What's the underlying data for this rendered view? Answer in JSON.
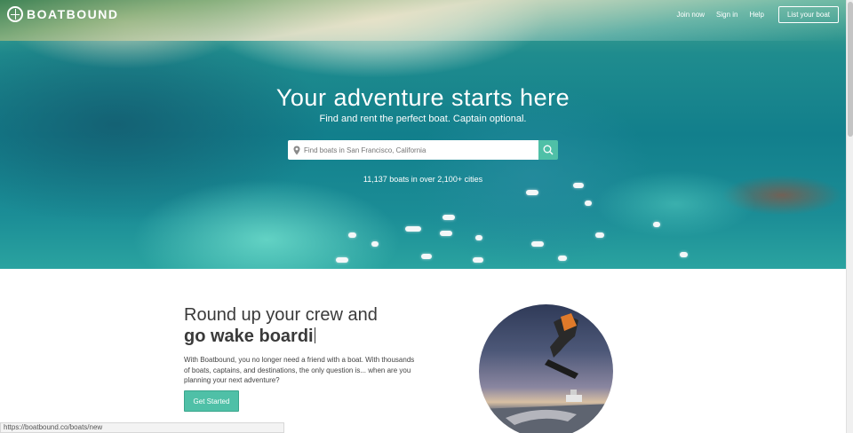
{
  "nav": {
    "logo_text": "BOATBOUND",
    "join_label": "Join now",
    "signin_label": "Sign in",
    "help_label": "Help",
    "list_boat_label": "List your boat"
  },
  "hero": {
    "title": "Your adventure starts here",
    "subtitle": "Find and rent the perfect boat. Captain optional.",
    "search_placeholder": "Find boats in San Francisco, California",
    "count_text": "11,137 boats in over 2,100+ cities"
  },
  "feature": {
    "headline_line1": "Round up your crew and",
    "headline_line2": "go wake boardi",
    "body": "With Boatbound, you no longer need a friend with a boat. With thousands of boats, captains, and destinations, the only question is... when are you planning your next adventure?",
    "cta_label": "Get Started"
  },
  "status_url": "https://boatbound.co/boats/new",
  "colors": {
    "accent": "#4fc0a7",
    "text_dark": "#3a3a3a"
  },
  "icons": {
    "logo": "anchor-wheel-icon",
    "search": "search-icon",
    "pin": "location-pin-icon"
  }
}
